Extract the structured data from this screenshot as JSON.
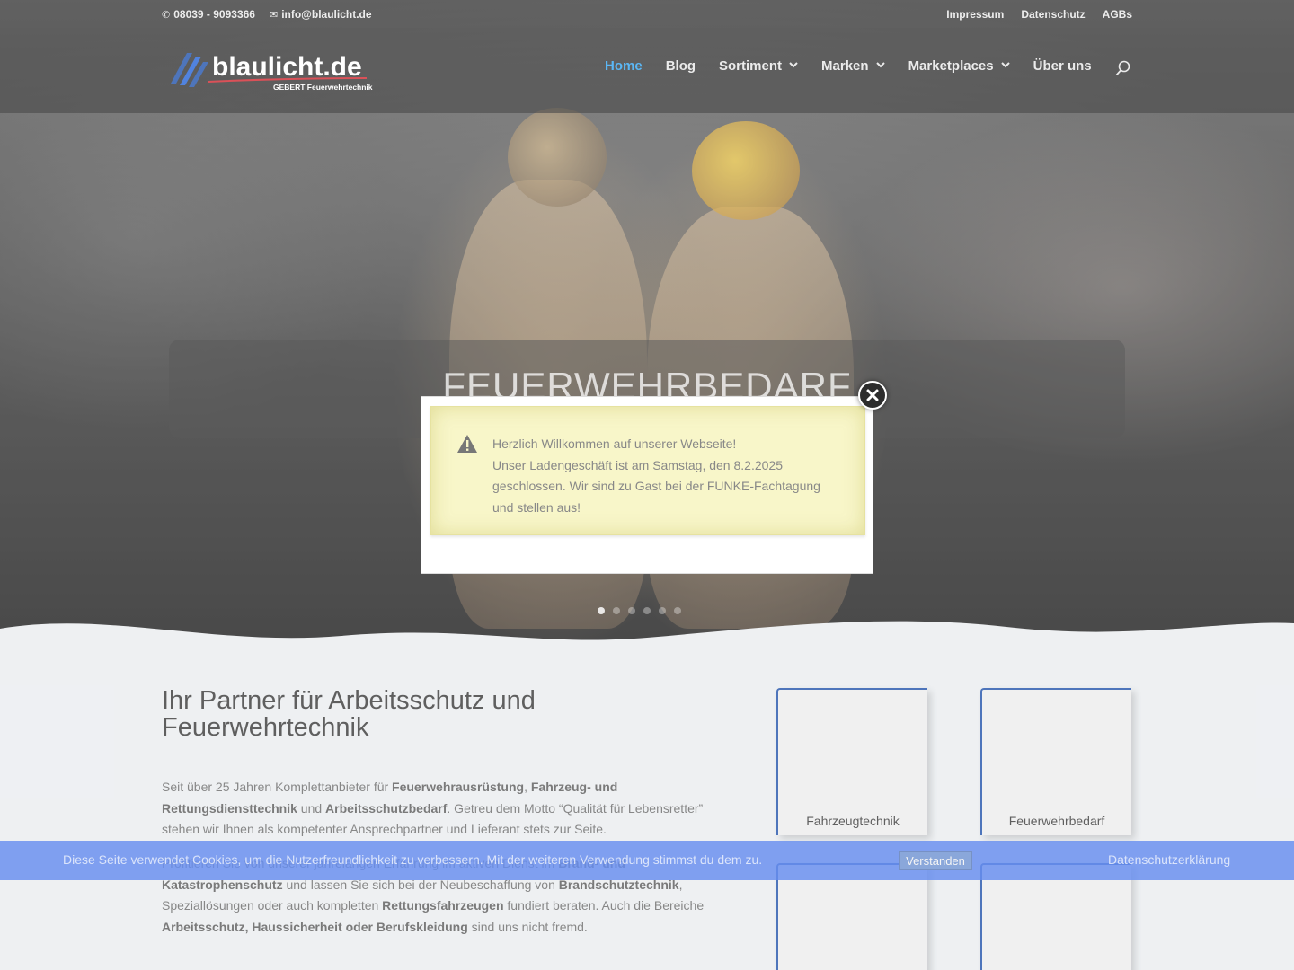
{
  "topbar": {
    "phone": "08039 - 9093366",
    "email": "info@blaulicht.de",
    "links": [
      "Impressum",
      "Datenschutz",
      "AGBs"
    ]
  },
  "logo": {
    "wordmark": "blaulicht.de",
    "tagline": "GEBERT Feuerwehrtechnik"
  },
  "nav": {
    "items": [
      {
        "label": "Home",
        "active": true,
        "dropdown": false
      },
      {
        "label": "Blog",
        "active": false,
        "dropdown": false
      },
      {
        "label": "Sortiment",
        "active": false,
        "dropdown": true
      },
      {
        "label": "Marken",
        "active": false,
        "dropdown": true
      },
      {
        "label": "Marketplaces",
        "active": false,
        "dropdown": true
      },
      {
        "label": "Über uns",
        "active": false,
        "dropdown": false
      }
    ],
    "dropdown_glyph": "3"
  },
  "hero": {
    "title": "FEUERWEHRBEDARF",
    "slides": 6,
    "active_slide": 1
  },
  "content": {
    "title": "Ihr Partner für Arbeitsschutz und Feuerwehrtechnik",
    "p1": [
      {
        "t": "Seit über 25 Jahren Komplettanbieter für ",
        "b": false
      },
      {
        "t": "Feuerwehrausrüstung",
        "b": true
      },
      {
        "t": ", ",
        "b": false
      },
      {
        "t": "Fahrzeug- und Rettungsdiensttechnik",
        "b": true
      },
      {
        "t": " und ",
        "b": false
      },
      {
        "t": "Arbeitsschutzbedarf",
        "b": true
      },
      {
        "t": ". Getreu dem Motto “Qualität für Lebensretter” stehen wir Ihnen als kompetenter Ansprechpartner und Lieferant stets zur Seite.",
        "b": false
      }
    ],
    "p2": [
      {
        "t": "Profitieren Sie von unserer jahrelangen Erfahrung im aktiven Dienst im ",
        "b": false
      },
      {
        "t": "Brand- und Katastrophenschutz",
        "b": true
      },
      {
        "t": " und lassen Sie sich bei der Neubeschaffung von ",
        "b": false
      },
      {
        "t": "Brandschutztechnik",
        "b": true
      },
      {
        "t": ", Speziallösungen oder auch kompletten ",
        "b": false
      },
      {
        "t": "Rettungsfahrzeugen",
        "b": true
      },
      {
        "t": " fundiert beraten. Auch die Bereiche ",
        "b": false
      },
      {
        "t": "Arbeitsschutz, Haussicherheit oder Berufskleidung",
        "b": true
      },
      {
        "t": " sind uns nicht fremd.",
        "b": false
      }
    ]
  },
  "cards": [
    {
      "label": "Fahrzeugtechnik"
    },
    {
      "label": "Feuerwehrbedarf"
    },
    {
      "label": ""
    },
    {
      "label": ""
    }
  ],
  "cookie": {
    "text": "Diese Seite verwendet Cookies, um die Nutzerfreundlichkeit zu verbessern. Mit der weiteren Verwendung stimmst du dem zu.",
    "button": "Verstanden",
    "link": "Datenschutzerklärung"
  },
  "modal": {
    "lines": [
      "Herzlich Willkommen auf unserer Webseite!",
      "Unser Ladengeschäft ist am Samstag, den 8.2.2025 geschlossen. Wir sind zu Gast bei der FUNKE-Fachtagung und stellen aus!"
    ]
  },
  "colors": {
    "accent": "#2ea3f2",
    "brand_blue": "#1d4fa8",
    "cookie_bar": "#3c6eeb",
    "notice_bg": "#f8f6c9"
  },
  "icons": [
    "phone-icon",
    "envelope-icon",
    "search-icon",
    "warning-icon",
    "close-icon",
    "chevron-down-icon"
  ]
}
